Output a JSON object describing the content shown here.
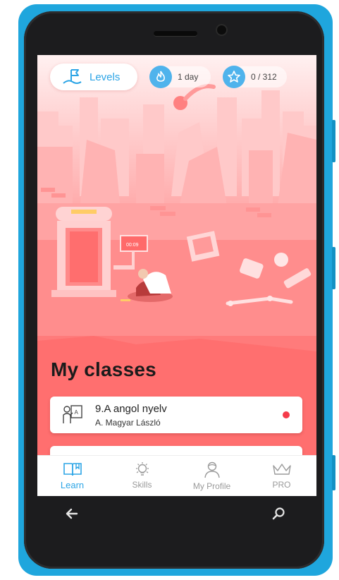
{
  "colors": {
    "accent": "#2da5e6",
    "hero_red": "#ff6f6f",
    "dot_red": "#f53b4a"
  },
  "top_bar": {
    "levels_label": "Levels",
    "streak_label": "1 day",
    "stars_label": "0 / 312",
    "levels_icon": "flag-icon",
    "streak_icon": "fire-icon",
    "stars_icon": "star-icon"
  },
  "illustration": {
    "timer_text": "00:09"
  },
  "classes": {
    "title": "My classes",
    "items": [
      {
        "title": "9.A angol nyelv",
        "teacher": "A. Magyar László",
        "icon": "teacher-icon"
      }
    ]
  },
  "nav": {
    "items": [
      {
        "label": "Learn",
        "icon": "book-icon"
      },
      {
        "label": "Skills",
        "icon": "lightbulb-icon"
      },
      {
        "label": "My Profile",
        "icon": "person-icon"
      },
      {
        "label": "PRO",
        "icon": "crown-icon"
      }
    ]
  }
}
